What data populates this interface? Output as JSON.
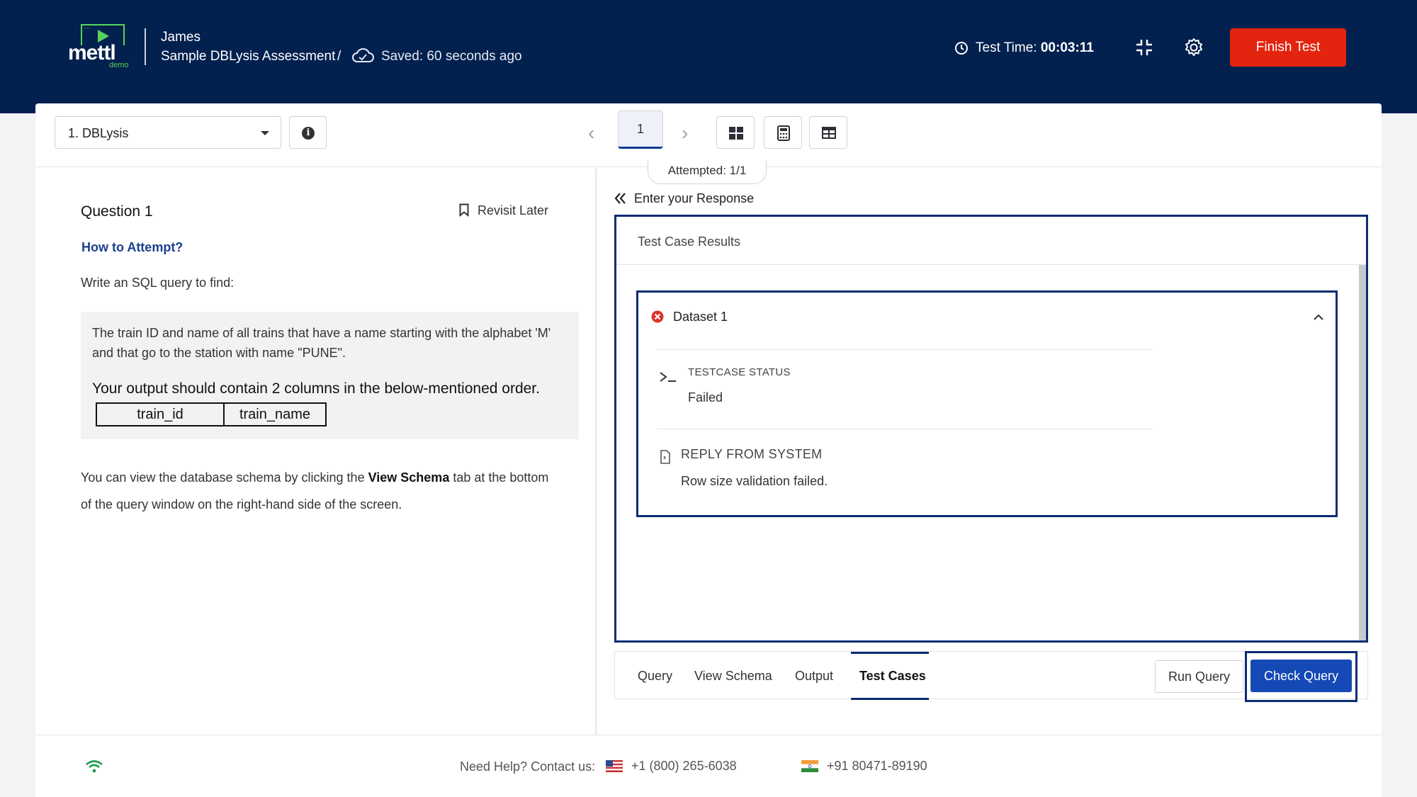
{
  "header": {
    "logo_text": "mettl",
    "logo_sub": "demo",
    "user_name": "James",
    "assessment_name": "Sample DBLysis Assessment",
    "separator": "/",
    "saved_status": "Saved: 60 seconds ago",
    "test_time_label": "Test Time:",
    "test_time_value": "00:03:11",
    "finish_label": "Finish Test",
    "colors": {
      "background": "#03214f",
      "finish": "#e3240f",
      "logo_accent": "#58d35a"
    }
  },
  "toolbar": {
    "section_select": "1. DBLysis",
    "current_question": "1",
    "attempted": "Attempted: 1/1"
  },
  "question": {
    "title": "Question 1",
    "revisit_label": "Revisit Later",
    "how_to": "How to Attempt?",
    "intro": "Write an SQL query to find:",
    "body": "The train ID and name of all trains that have a name starting with the alphabet 'M' and that go to the station with name \"PUNE\".",
    "output_note": "Your output should contain 2 columns in the below-mentioned order.",
    "columns": [
      "train_id",
      "train_name"
    ],
    "schema_pre": "You can view the database schema by clicking the ",
    "schema_bold": "View Schema",
    "schema_post": " tab at the bottom of the query window on the right-hand side of the screen."
  },
  "response": {
    "heading": "Enter your Response",
    "panel_title": "Test Case Results",
    "dataset": {
      "name": "Dataset 1",
      "status_label": "TESTCASE STATUS",
      "status_value": "Failed",
      "reply_label": "REPLY FROM SYSTEM",
      "reply_value": "Row size validation failed."
    },
    "tabs": [
      "Query",
      "View Schema",
      "Output",
      "Test Cases"
    ],
    "active_tab": "Test Cases",
    "run_label": "Run Query",
    "check_label": "Check Query",
    "colors": {
      "accent": "#0b2c74",
      "check": "#1549b5",
      "fail": "#d9342b"
    }
  },
  "footer": {
    "help_label": "Need Help? Contact us:",
    "phone_us": "+1 (800) 265-6038",
    "phone_in": "+91 80471-89190"
  }
}
